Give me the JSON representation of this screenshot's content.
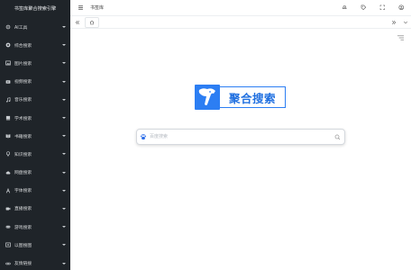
{
  "sidebar": {
    "brand": "书签库聚合搜索引擎",
    "items": [
      {
        "label": "AI工具",
        "icon": "gear-icon"
      },
      {
        "label": "综合搜索",
        "icon": "globe-icon"
      },
      {
        "label": "图片搜索",
        "icon": "image-icon"
      },
      {
        "label": "视频搜索",
        "icon": "video-icon"
      },
      {
        "label": "音乐搜索",
        "icon": "music-icon"
      },
      {
        "label": "学术搜索",
        "icon": "book-icon"
      },
      {
        "label": "书籍搜索",
        "icon": "book-open-icon"
      },
      {
        "label": "知识搜索",
        "icon": "lightbulb-icon"
      },
      {
        "label": "网盘搜索",
        "icon": "cloud-icon"
      },
      {
        "label": "字体搜索",
        "icon": "font-icon"
      },
      {
        "label": "直播搜索",
        "icon": "camera-icon"
      },
      {
        "label": "游戏搜索",
        "icon": "gamepad-icon"
      },
      {
        "label": "以图搜图",
        "icon": "picture-search-icon"
      },
      {
        "label": "友情链接",
        "icon": "link-icon"
      }
    ]
  },
  "header": {
    "title": "书签库"
  },
  "logo": {
    "text": "聚合搜索"
  },
  "search": {
    "placeholder": "百度搜索",
    "engine_icon": "baidu-paw-icon"
  },
  "colors": {
    "sidebar_bg": "#1f2429",
    "accent": "#2c7ef3"
  }
}
